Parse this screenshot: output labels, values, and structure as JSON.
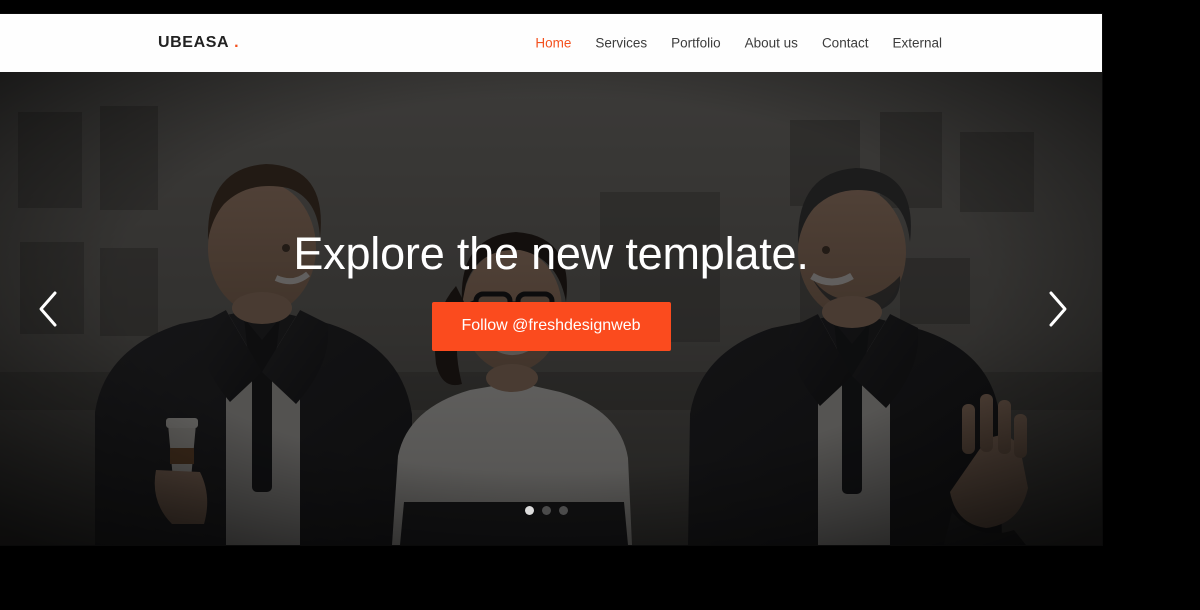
{
  "header": {
    "logo_text": "UBEASA",
    "logo_dot": ".",
    "nav": [
      {
        "label": "Home",
        "active": true
      },
      {
        "label": "Services",
        "active": false
      },
      {
        "label": "Portfolio",
        "active": false
      },
      {
        "label": "About us",
        "active": false
      },
      {
        "label": "Contact",
        "active": false
      },
      {
        "label": "External",
        "active": false
      }
    ]
  },
  "hero": {
    "title": "Explore the new template.",
    "cta_label": "Follow @freshdesignweb",
    "prev_arrow": "chevron-left-icon",
    "next_arrow": "chevron-right-icon",
    "slides": [
      {
        "index": 1,
        "active": true
      },
      {
        "index": 2,
        "active": false
      },
      {
        "index": 3,
        "active": false
      }
    ],
    "image_description": "Three business people in dark suits talking and smiling outdoors"
  },
  "colors": {
    "accent": "#fb4b1e",
    "accent_logo_dot": "#f4511e",
    "header_bg": "#fefefe",
    "nav_text": "#3c3c3c",
    "hero_text": "#ffffff",
    "dot_active": "#dcdcdc",
    "dot_inactive": "#4b4b4b",
    "letterbox": "#000000"
  }
}
